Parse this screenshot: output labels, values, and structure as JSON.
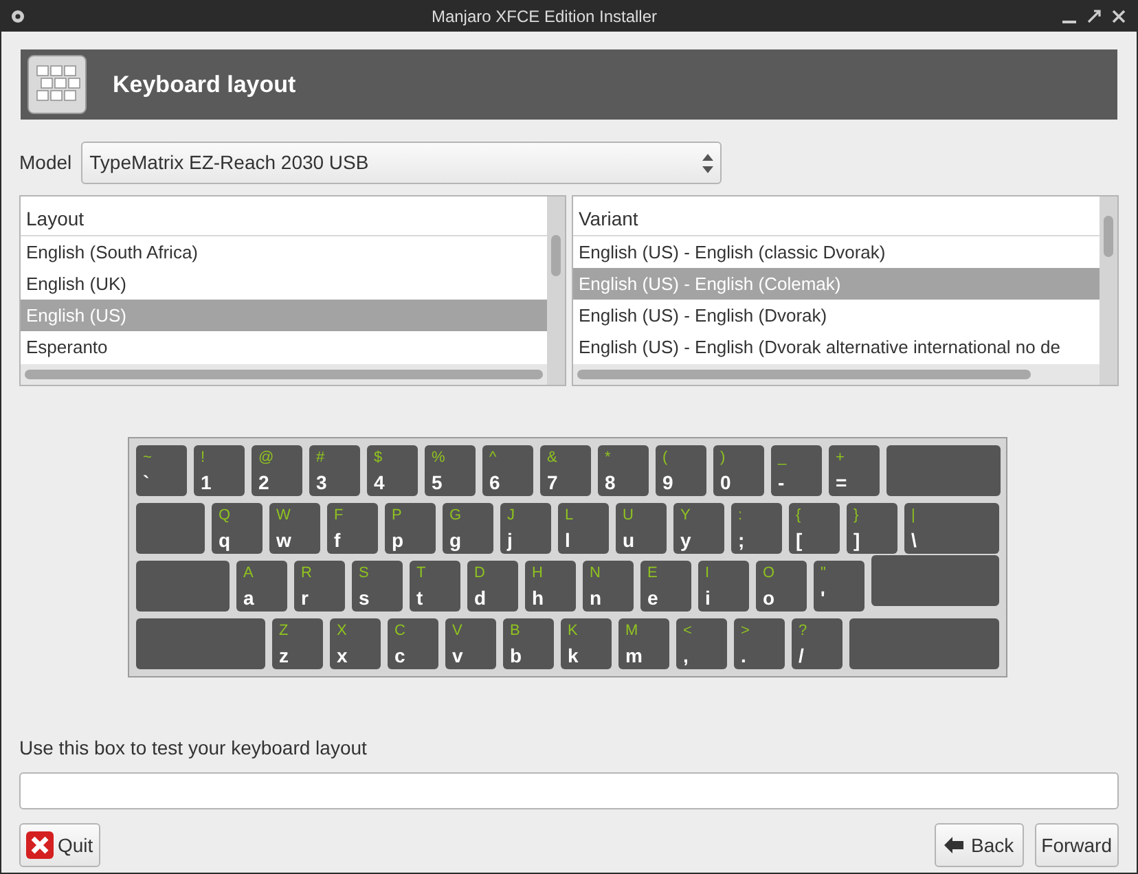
{
  "window": {
    "title": "Manjaro XFCE Edition Installer"
  },
  "header": {
    "title": "Keyboard layout"
  },
  "model": {
    "label": "Model",
    "value": "TypeMatrix EZ-Reach 2030 USB"
  },
  "layout_list": {
    "heading": "Layout",
    "items": [
      {
        "label": "English (South Africa)",
        "selected": false
      },
      {
        "label": "English (UK)",
        "selected": false
      },
      {
        "label": "English (US)",
        "selected": true
      },
      {
        "label": "Esperanto",
        "selected": false
      }
    ]
  },
  "variant_list": {
    "heading": "Variant",
    "items": [
      {
        "label": "English (US) - English (classic Dvorak)",
        "selected": false
      },
      {
        "label": "English (US) - English (Colemak)",
        "selected": true
      },
      {
        "label": "English (US) - English (Dvorak)",
        "selected": false
      },
      {
        "label": "English (US) - English (Dvorak alternative international no de",
        "selected": false
      }
    ]
  },
  "keyboard": {
    "rows": [
      [
        {
          "kind": "char",
          "upper": "~",
          "lower": "`"
        },
        {
          "kind": "char",
          "upper": "!",
          "lower": "1"
        },
        {
          "kind": "char",
          "upper": "@",
          "lower": "2"
        },
        {
          "kind": "char",
          "upper": "#",
          "lower": "3"
        },
        {
          "kind": "char",
          "upper": "$",
          "lower": "4"
        },
        {
          "kind": "char",
          "upper": "%",
          "lower": "5"
        },
        {
          "kind": "char",
          "upper": "^",
          "lower": "6"
        },
        {
          "kind": "char",
          "upper": "&",
          "lower": "7"
        },
        {
          "kind": "char",
          "upper": "*",
          "lower": "8"
        },
        {
          "kind": "char",
          "upper": "(",
          "lower": "9"
        },
        {
          "kind": "char",
          "upper": ")",
          "lower": "0"
        },
        {
          "kind": "char",
          "upper": "_",
          "lower": "-"
        },
        {
          "kind": "char",
          "upper": "+",
          "lower": "="
        },
        {
          "kind": "backspace"
        }
      ],
      [
        {
          "kind": "tab"
        },
        {
          "kind": "char",
          "upper": "Q",
          "lower": "q"
        },
        {
          "kind": "char",
          "upper": "W",
          "lower": "w"
        },
        {
          "kind": "char",
          "upper": "F",
          "lower": "f"
        },
        {
          "kind": "char",
          "upper": "P",
          "lower": "p"
        },
        {
          "kind": "char",
          "upper": "G",
          "lower": "g"
        },
        {
          "kind": "char",
          "upper": "J",
          "lower": "j"
        },
        {
          "kind": "char",
          "upper": "L",
          "lower": "l"
        },
        {
          "kind": "char",
          "upper": "U",
          "lower": "u"
        },
        {
          "kind": "char",
          "upper": "Y",
          "lower": "y"
        },
        {
          "kind": "char",
          "upper": ":",
          "lower": ";"
        },
        {
          "kind": "char",
          "upper": "{",
          "lower": "["
        },
        {
          "kind": "char",
          "upper": "}",
          "lower": "]"
        },
        {
          "kind": "backslash",
          "upper": "|",
          "lower": "\\"
        }
      ],
      [
        {
          "kind": "caps"
        },
        {
          "kind": "char",
          "upper": "A",
          "lower": "a"
        },
        {
          "kind": "char",
          "upper": "R",
          "lower": "r"
        },
        {
          "kind": "char",
          "upper": "S",
          "lower": "s"
        },
        {
          "kind": "char",
          "upper": "T",
          "lower": "t"
        },
        {
          "kind": "char",
          "upper": "D",
          "lower": "d"
        },
        {
          "kind": "char",
          "upper": "H",
          "lower": "h"
        },
        {
          "kind": "char",
          "upper": "N",
          "lower": "n"
        },
        {
          "kind": "char",
          "upper": "E",
          "lower": "e"
        },
        {
          "kind": "char",
          "upper": "I",
          "lower": "i"
        },
        {
          "kind": "char",
          "upper": "O",
          "lower": "o"
        },
        {
          "kind": "char",
          "upper": "\"",
          "lower": "'"
        },
        {
          "kind": "enter"
        }
      ],
      [
        {
          "kind": "shift"
        },
        {
          "kind": "char",
          "upper": "Z",
          "lower": "z"
        },
        {
          "kind": "char",
          "upper": "X",
          "lower": "x"
        },
        {
          "kind": "char",
          "upper": "C",
          "lower": "c"
        },
        {
          "kind": "char",
          "upper": "V",
          "lower": "v"
        },
        {
          "kind": "char",
          "upper": "B",
          "lower": "b"
        },
        {
          "kind": "char",
          "upper": "K",
          "lower": "k"
        },
        {
          "kind": "char",
          "upper": "M",
          "lower": "m"
        },
        {
          "kind": "char",
          "upper": "<",
          "lower": ","
        },
        {
          "kind": "char",
          "upper": ">",
          "lower": "."
        },
        {
          "kind": "char",
          "upper": "?",
          "lower": "/"
        },
        {
          "kind": "shift"
        }
      ]
    ]
  },
  "test": {
    "label": "Use this box to test your keyboard layout"
  },
  "buttons": {
    "quit": "Quit",
    "back": "Back",
    "forward": "Forward"
  }
}
